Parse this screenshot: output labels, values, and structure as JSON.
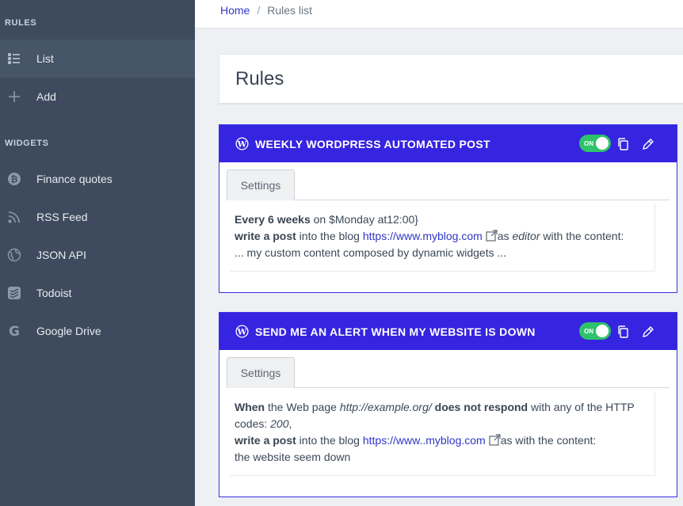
{
  "sidebar": {
    "sections": [
      {
        "title": "RULES",
        "items": [
          {
            "label": "List",
            "icon": "list-icon",
            "active": true
          },
          {
            "label": "Add",
            "icon": "plus-icon",
            "active": false
          }
        ]
      },
      {
        "title": "WIDGETS",
        "items": [
          {
            "label": "Finance quotes",
            "icon": "bitcoin-icon"
          },
          {
            "label": "RSS Feed",
            "icon": "rss-icon"
          },
          {
            "label": "JSON API",
            "icon": "globe-icon"
          },
          {
            "label": "Todoist",
            "icon": "todoist-icon"
          },
          {
            "label": "Google Drive",
            "icon": "google-icon"
          }
        ]
      }
    ]
  },
  "breadcrumb": {
    "home": "Home",
    "separator": "/",
    "current": "Rules list"
  },
  "page": {
    "title": "Rules"
  },
  "rules": [
    {
      "icon": "wordpress-icon",
      "title": "WEEKLY WORDPRESS AUTOMATED POST",
      "toggle_label": "ON",
      "enabled": true,
      "tab": "Settings",
      "line1": {
        "bold": "Every 6 weeks",
        "text": " on $Monday at12:00}"
      },
      "line2": {
        "bold": "write a post",
        "text1": " into the blog ",
        "link": "https://www.myblog.com",
        "text2": "as ",
        "role": "editor",
        "text3": " with the content:"
      },
      "line3": "... my custom content composed by dynamic widgets ..."
    },
    {
      "icon": "wordpress-icon",
      "title": "SEND ME AN ALERT WHEN MY WEBSITE IS DOWN",
      "toggle_label": "ON",
      "enabled": true,
      "tab": "Settings",
      "line1": {
        "bold1": "When",
        "text1": " the Web page ",
        "url": "http://example.org/",
        "bold2": "does not respond",
        "text2": " with any of the HTTP codes: ",
        "codes": "200",
        "text3": ","
      },
      "line2": {
        "bold": "write a post",
        "text1": " into the blog ",
        "link": "https://www..myblog.com",
        "text2": "as  with the content:"
      },
      "line3": "the website seem down"
    }
  ],
  "colors": {
    "sidebar": "#3e4b5e",
    "accent": "#3524e0",
    "toggle_on": "#2ec26b",
    "link": "#2f36c6"
  }
}
